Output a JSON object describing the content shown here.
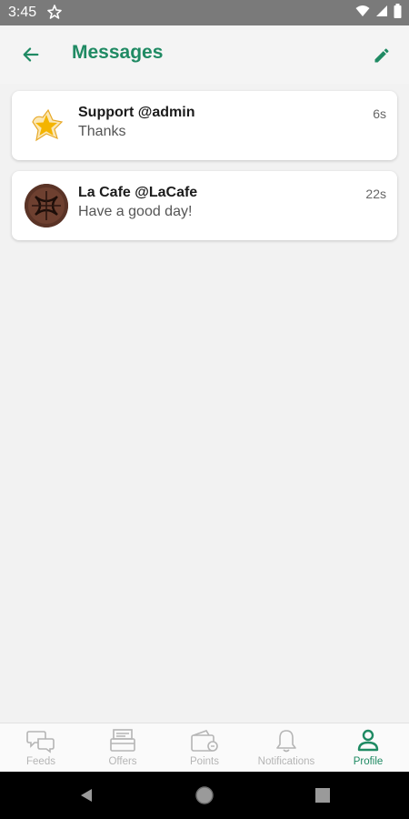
{
  "status_bar": {
    "time": "3:45"
  },
  "header": {
    "title": "Messages"
  },
  "messages": [
    {
      "name": "Support @admin",
      "preview": "Thanks",
      "time": "6s"
    },
    {
      "name": "La Cafe @LaCafe",
      "preview": "Have a good day!",
      "time": "22s"
    }
  ],
  "bottom_nav": {
    "items": [
      {
        "label": "Feeds",
        "icon": "chat-bubbles-icon"
      },
      {
        "label": "Offers",
        "icon": "offers-icon"
      },
      {
        "label": "Points",
        "icon": "wallet-icon"
      },
      {
        "label": "Notifications",
        "icon": "bell-icon"
      },
      {
        "label": "Profile",
        "icon": "person-icon"
      }
    ],
    "active_index": 4
  },
  "colors": {
    "accent": "#1f8a63",
    "inactive": "#b5b5b5",
    "status_bar": "#7a7a7a",
    "background": "#f2f2f2"
  }
}
